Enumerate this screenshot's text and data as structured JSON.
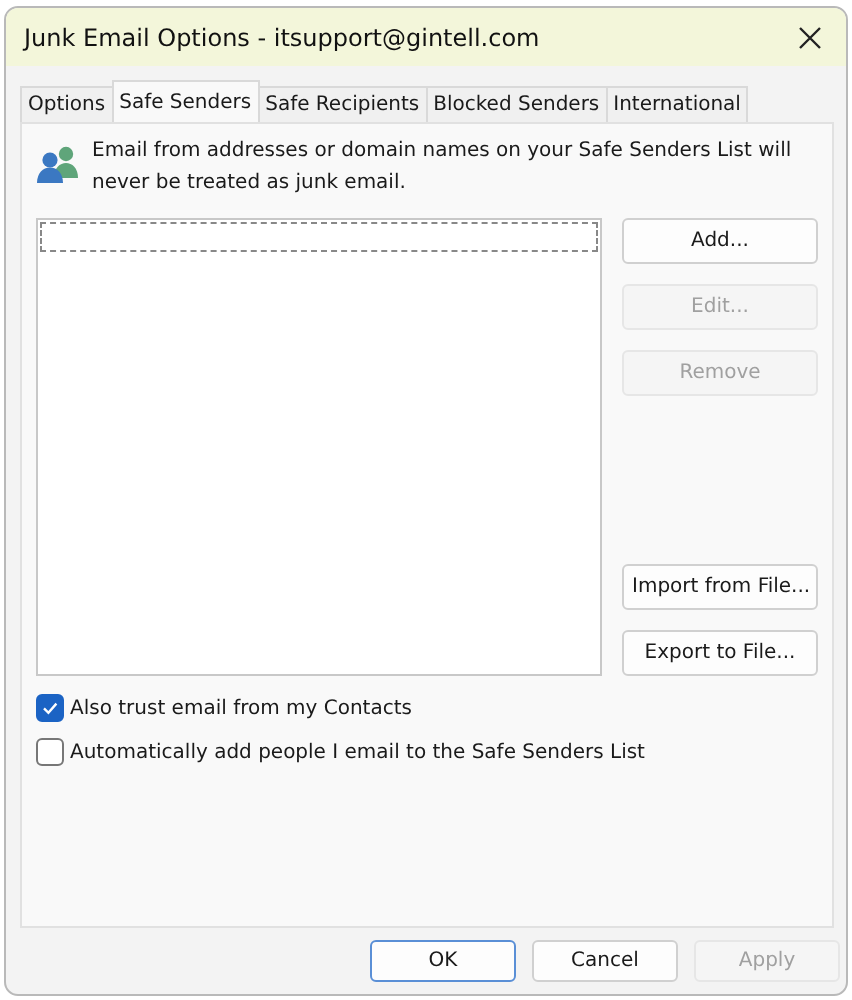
{
  "window": {
    "title": "Junk Email Options - itsupport@gintell.com"
  },
  "tabs": [
    {
      "label": "Options",
      "selected": false
    },
    {
      "label": "Safe Senders",
      "selected": true
    },
    {
      "label": "Safe Recipients",
      "selected": false
    },
    {
      "label": "Blocked Senders",
      "selected": false
    },
    {
      "label": "International",
      "selected": false
    }
  ],
  "description": "Email from addresses or domain names on your Safe Senders List will never be treated as junk email.",
  "side_buttons_top": [
    {
      "label": "Add...",
      "disabled": false
    },
    {
      "label": "Edit...",
      "disabled": true
    },
    {
      "label": "Remove",
      "disabled": true
    }
  ],
  "side_buttons_bottom": [
    {
      "label": "Import from File...",
      "disabled": false
    },
    {
      "label": "Export to File...",
      "disabled": false
    }
  ],
  "checkboxes": [
    {
      "label": "Also trust email from my Contacts",
      "checked": true
    },
    {
      "label": "Automatically add people I email to the Safe Senders List",
      "checked": false
    }
  ],
  "footer_buttons": [
    {
      "label": "OK",
      "disabled": false,
      "default": true
    },
    {
      "label": "Cancel",
      "disabled": false,
      "default": false
    },
    {
      "label": "Apply",
      "disabled": true,
      "default": false
    }
  ]
}
